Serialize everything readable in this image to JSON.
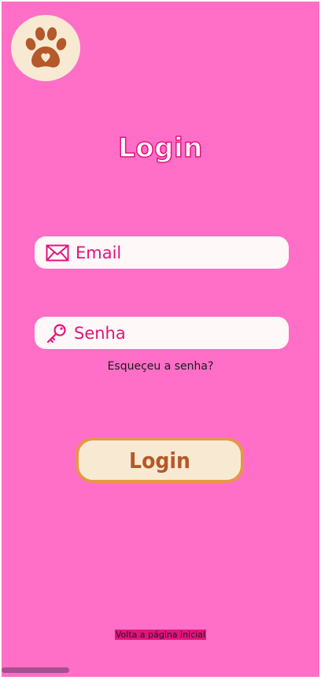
{
  "brand": {
    "logo_icon": "paw-heart-icon"
  },
  "page": {
    "title": "Login"
  },
  "form": {
    "email_placeholder": "Email",
    "password_placeholder": "Senha",
    "forgot_password": "Esqueçeu a senha?",
    "submit_label": "Login"
  },
  "footer": {
    "home_link": "Volta a página inicial"
  },
  "colors": {
    "background": "#ff6ec7",
    "accent": "#e2137d",
    "button_fill": "#f8ead2",
    "button_border": "#e7964a",
    "button_text": "#b5582a"
  }
}
